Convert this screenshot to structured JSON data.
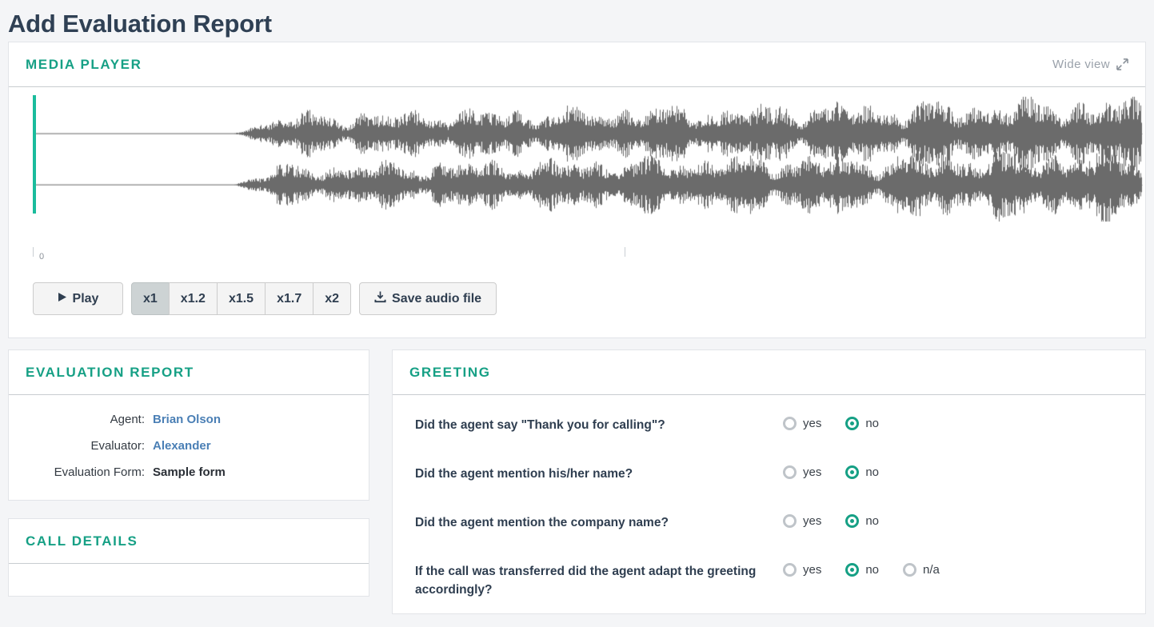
{
  "page": {
    "title": "Add Evaluation Report"
  },
  "media_player": {
    "title": "MEDIA PLAYER",
    "wide_view_label": "Wide view",
    "wide_view_icon": "expand-arrows-icon",
    "timeline": {
      "start_label": "0"
    },
    "play_button": {
      "label": "Play",
      "icon": "play-icon"
    },
    "speeds": [
      {
        "label": "x1",
        "active": true
      },
      {
        "label": "x1.2",
        "active": false
      },
      {
        "label": "x1.5",
        "active": false
      },
      {
        "label": "x1.7",
        "active": false
      },
      {
        "label": "x2",
        "active": false
      }
    ],
    "save_button": {
      "label": "Save audio file",
      "icon": "download-icon"
    },
    "colors": {
      "accent": "#16a085",
      "playhead": "#1abc9c",
      "waveform": "#6b6b6b"
    }
  },
  "evaluation_report": {
    "title": "EVALUATION REPORT",
    "rows": [
      {
        "label": "Agent:",
        "value": "Brian Olson",
        "link": true
      },
      {
        "label": "Evaluator:",
        "value": "Alexander",
        "link": true
      },
      {
        "label": "Evaluation Form:",
        "value": "Sample form",
        "link": false
      }
    ]
  },
  "call_details": {
    "title": "CALL DETAILS"
  },
  "greeting": {
    "title": "GREETING",
    "questions": [
      {
        "text": "Did the agent say \"Thank you for calling\"?",
        "options": [
          {
            "label": "yes",
            "checked": false
          },
          {
            "label": "no",
            "checked": true
          }
        ]
      },
      {
        "text": "Did the agent mention his/her name?",
        "options": [
          {
            "label": "yes",
            "checked": false
          },
          {
            "label": "no",
            "checked": true
          }
        ]
      },
      {
        "text": "Did the agent mention the company name?",
        "options": [
          {
            "label": "yes",
            "checked": false
          },
          {
            "label": "no",
            "checked": true
          }
        ]
      },
      {
        "text": "If the call was transferred did the agent adapt the greeting accordingly?",
        "options": [
          {
            "label": "yes",
            "checked": false
          },
          {
            "label": "no",
            "checked": true
          },
          {
            "label": "n/a",
            "checked": false
          }
        ]
      }
    ]
  }
}
